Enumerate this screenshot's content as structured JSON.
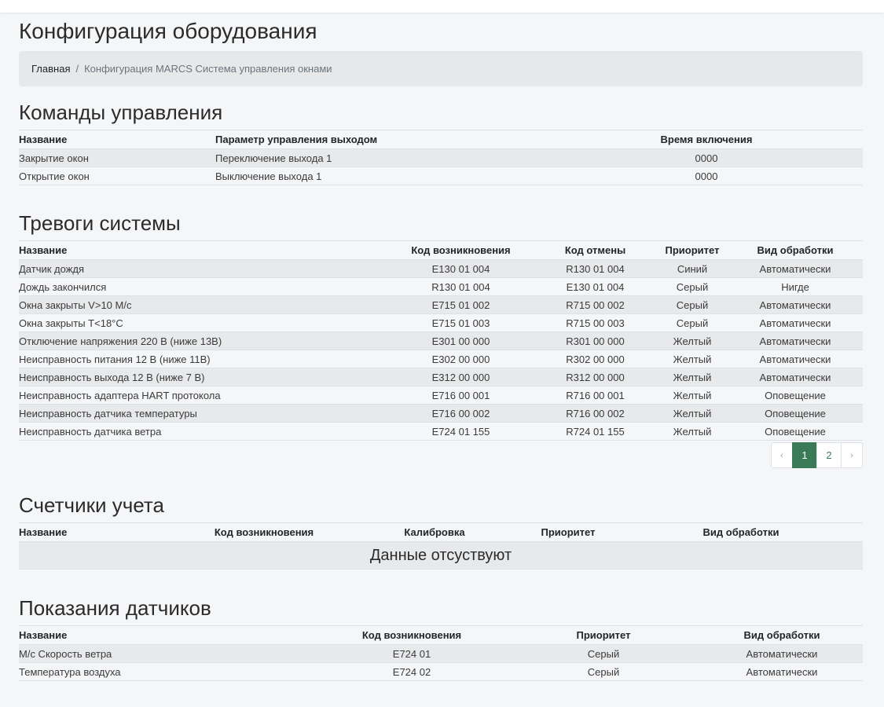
{
  "page": {
    "title": "Конфигурация оборудования"
  },
  "breadcrumb": {
    "home": "Главная",
    "separator": "/",
    "current": "Конфигурация MARCS Система управления окнами"
  },
  "commands": {
    "title": "Команды управления",
    "headers": [
      "Название",
      "Параметр управления выходом",
      "Время включения"
    ],
    "rows": [
      [
        "Закрытие окон",
        "Переключение выхода 1",
        "0000"
      ],
      [
        "Открытие окон",
        "Выключение выхода 1",
        "0000"
      ]
    ]
  },
  "alarms": {
    "title": "Тревоги системы",
    "headers": [
      "Название",
      "Код возникновения",
      "Код отмены",
      "Приоритет",
      "Вид обработки"
    ],
    "rows": [
      [
        "Датчик дождя",
        "E130 01 004",
        "R130 01 004",
        "Синий",
        "Автоматически"
      ],
      [
        "Дождь закончился",
        "R130 01 004",
        "E130 01 004",
        "Серый",
        "Нигде"
      ],
      [
        "Окна закрыты V>10 М/с",
        "E715 01 002",
        "R715 00 002",
        "Серый",
        "Автоматически"
      ],
      [
        "Окна закрыты T<18°С",
        "E715 01 003",
        "R715 00 003",
        "Серый",
        "Автоматически"
      ],
      [
        "Отключение напряжения 220 В (ниже 13В)",
        "E301 00 000",
        "R301 00 000",
        "Желтый",
        "Автоматически"
      ],
      [
        "Неисправность питания 12 В (ниже 11В)",
        "E302 00 000",
        "R302 00 000",
        "Желтый",
        "Автоматически"
      ],
      [
        "Неисправность выхода 12 В (ниже 7 В)",
        "E312 00 000",
        "R312 00 000",
        "Желтый",
        "Автоматически"
      ],
      [
        "Неисправность адаптера HART протокола",
        "E716 00 001",
        "R716 00 001",
        "Желтый",
        "Оповещение"
      ],
      [
        "Неисправность датчика температуры",
        "E716 00 002",
        "R716 00 002",
        "Желтый",
        "Оповещение"
      ],
      [
        "Неисправность датчика ветра",
        "E724 01 155",
        "R724 01 155",
        "Желтый",
        "Оповещение"
      ]
    ],
    "pagination": {
      "prev": "‹",
      "pages": [
        "1",
        "2"
      ],
      "active": "1",
      "next": "›"
    }
  },
  "counters": {
    "title": "Счетчики учета",
    "headers": [
      "Название",
      "Код возникновения",
      "Калибровка",
      "Приоритет",
      "Вид обработки"
    ],
    "empty_text": "Данные отсуствуют"
  },
  "sensors": {
    "title": "Показания датчиков",
    "headers": [
      "Название",
      "Код возникновения",
      "Приоритет",
      "Вид обработки"
    ],
    "rows": [
      [
        "М/с Скорость ветра",
        "E724 01",
        "Серый",
        "Автоматически"
      ],
      [
        "Температура воздуха",
        "E724 02",
        "Серый",
        "Автоматически"
      ]
    ]
  },
  "colors": {
    "accent": "#3b7a57",
    "stripe": "#e8e9eb",
    "background": "#f5f6f8"
  }
}
